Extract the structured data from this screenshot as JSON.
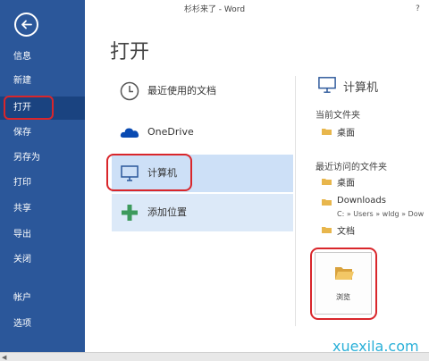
{
  "window": {
    "title": "杉杉来了 - Word",
    "help": "?"
  },
  "sidebar": {
    "items": [
      {
        "label": "信息"
      },
      {
        "label": "新建"
      },
      {
        "label": "打开"
      },
      {
        "label": "保存"
      },
      {
        "label": "另存为"
      },
      {
        "label": "打印"
      },
      {
        "label": "共享"
      },
      {
        "label": "导出"
      },
      {
        "label": "关闭"
      },
      {
        "label": "帐户"
      },
      {
        "label": "选项"
      }
    ],
    "active": "打开"
  },
  "main": {
    "title": "打开",
    "locations": [
      {
        "label": "最近使用的文档",
        "icon": "clock-icon"
      },
      {
        "label": "OneDrive",
        "icon": "cloud-icon"
      },
      {
        "label": "计算机",
        "icon": "computer-icon"
      },
      {
        "label": "添加位置",
        "icon": "plus-icon"
      }
    ]
  },
  "right_panel": {
    "title": "计算机",
    "current_folder_label": "当前文件夹",
    "current_folder": {
      "name": "桌面"
    },
    "recent_folders_label": "最近访问的文件夹",
    "recent_folders": [
      {
        "name": "桌面"
      },
      {
        "name": "Downloads",
        "path": "C: » Users » wldg » Dow"
      },
      {
        "name": "文档"
      }
    ],
    "browse_label": "浏览"
  },
  "watermark": "xuexila.com",
  "colors": {
    "sidebar": "#2b579a",
    "selected": "#cde0f7",
    "highlight": "#d9262b",
    "accent": "#2b579a"
  }
}
